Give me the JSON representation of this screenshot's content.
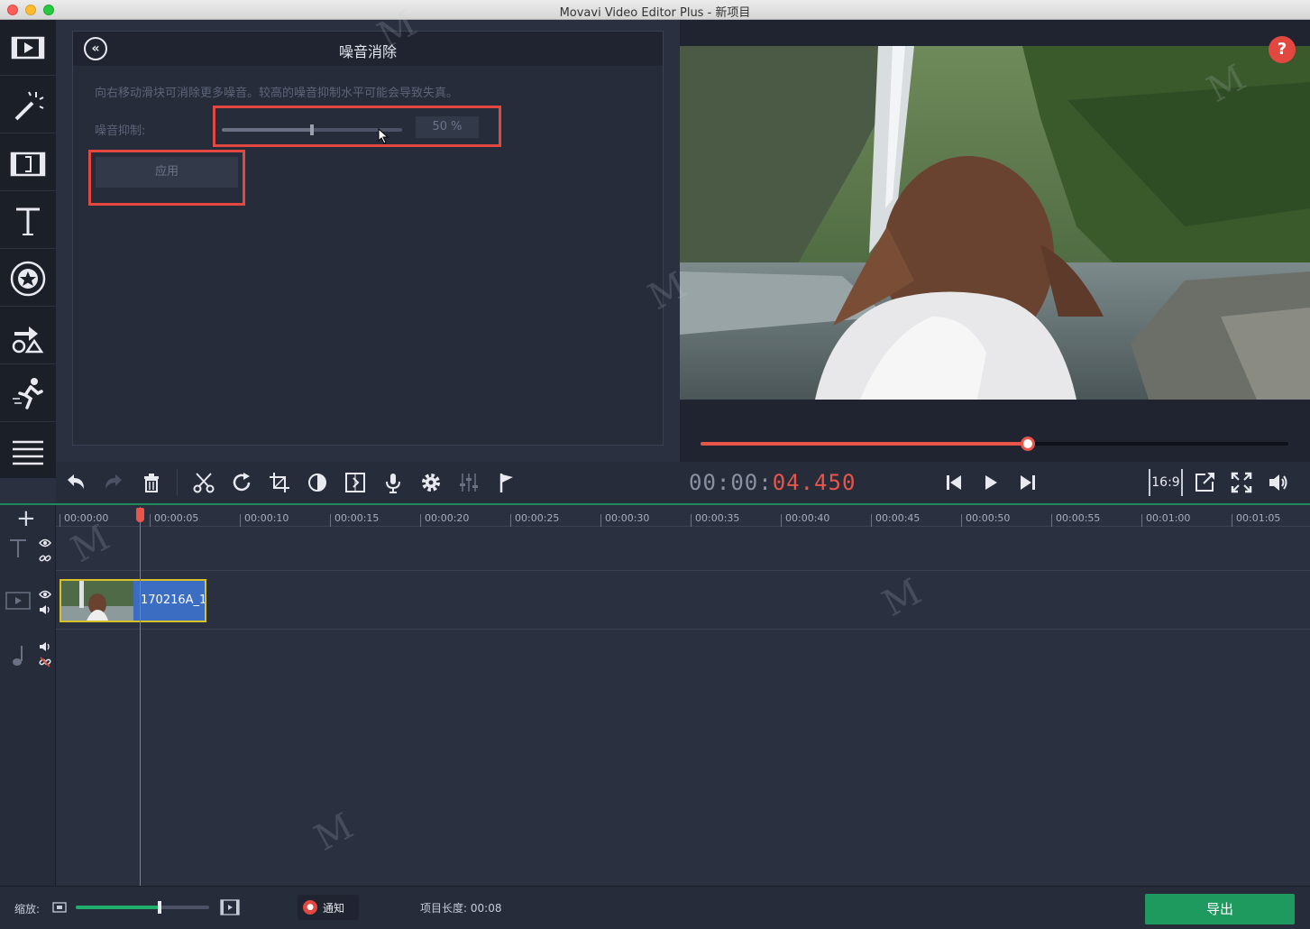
{
  "window": {
    "title": "Movavi Video Editor Plus - 新项目"
  },
  "sidebar": {
    "items": [
      {
        "name": "import",
        "icon": "film-import-icon"
      },
      {
        "name": "filters",
        "icon": "magic-wand-icon"
      },
      {
        "name": "transitions",
        "icon": "film-transition-icon"
      },
      {
        "name": "titles",
        "icon": "text-t-icon"
      },
      {
        "name": "stickers",
        "icon": "star-badge-icon"
      },
      {
        "name": "callouts",
        "icon": "shapes-arrow-icon"
      },
      {
        "name": "motion",
        "icon": "running-man-icon"
      },
      {
        "name": "more",
        "icon": "list-icon"
      }
    ]
  },
  "panel": {
    "title": "噪音消除",
    "description": "向右移动滑块可消除更多噪音。较高的噪音抑制水平可能会导致失真。",
    "nr_label": "噪音抑制:",
    "nr_value": "50 %",
    "nr_fraction": 0.5,
    "apply_label": "应用",
    "highlight_color": "#e2483f"
  },
  "preview": {
    "help_label": "?",
    "progress_fraction": 0.557,
    "accent": "#e8564a"
  },
  "toolbar": {
    "tools": [
      "undo-icon",
      "redo-icon",
      "delete-icon",
      "cut-icon",
      "rotate-icon",
      "crop-icon",
      "color-icon",
      "transition-wizard-icon",
      "microphone-icon",
      "settings-icon",
      "equalizer-icon",
      "marker-flag-icon"
    ],
    "timecode_dim": "00:00:",
    "timecode_active": "04.450",
    "ratio_label": "16:9"
  },
  "timeline": {
    "add_label": "+",
    "ticks": [
      "00:00:00",
      "00:00:05",
      "00:00:10",
      "00:00:15",
      "00:00:20",
      "00:00:25",
      "00:00:30",
      "00:00:35",
      "00:00:40",
      "00:00:45",
      "00:00:50",
      "00:00:55",
      "00:01:00",
      "00:01:05"
    ],
    "clip_label": "170216A_1"
  },
  "bottombar": {
    "zoom_label": "缩放:",
    "zoom_fraction": 0.63,
    "notify_label": "通知",
    "project_length_label": "项目长度:",
    "project_length_value": "00:08",
    "export_label": "导出",
    "accent": "#1e9a5e"
  }
}
